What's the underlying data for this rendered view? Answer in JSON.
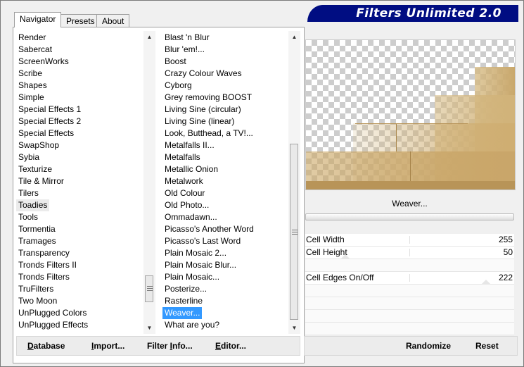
{
  "banner": {
    "title": "Filters Unlimited 2.0"
  },
  "tabs": [
    {
      "label": "Navigator",
      "active": true
    },
    {
      "label": "Presets",
      "active": false
    },
    {
      "label": "About",
      "active": false
    }
  ],
  "categories": {
    "items": [
      "Render",
      "Sabercat",
      "ScreenWorks",
      "Scribe",
      "Shapes",
      "Simple",
      "Special Effects 1",
      "Special Effects 2",
      "Special Effects",
      "SwapShop",
      "Sybia",
      "Texturize",
      "Tile & Mirror",
      "Tilers",
      "Toadies",
      "Tools",
      "Tormentia",
      "Tramages",
      "Transparency",
      "Tronds Filters II",
      "Tronds Filters",
      "TruFilters",
      "Two Moon",
      "UnPlugged Colors",
      "UnPlugged Effects"
    ],
    "selected": "Toadies"
  },
  "filters": {
    "items": [
      "Blast 'n Blur",
      "Blur 'em!...",
      "Boost",
      "Crazy Colour Waves",
      "Cyborg",
      "Grey removing BOOST",
      "Living Sine (circular)",
      "Living Sine (linear)",
      "Look, Butthead, a TV!...",
      "Metalfalls II...",
      "Metalfalls",
      "Metallic Onion",
      "Metalwork",
      "Old Colour",
      "Old Photo...",
      "Ommadawn...",
      "Picasso's Another Word",
      "Picasso's Last Word",
      "Plain Mosaic 2...",
      "Plain Mosaic Blur...",
      "Plain Mosaic...",
      "Posterize...",
      "Rasterline",
      "Weaver...",
      "What are you?"
    ],
    "selected": "Weaver..."
  },
  "preview": {
    "filter_name": "Weaver...",
    "accent": "#c9a86c"
  },
  "params": [
    {
      "label": "Cell Width",
      "value": "255",
      "fraction": 1.0
    },
    {
      "label": "Cell Height",
      "value": "50",
      "fraction": 0.196
    },
    {
      "label": "Cell Edges On/Off",
      "value": "222",
      "fraction": 0.871
    }
  ],
  "buttons": {
    "database": {
      "u": "D",
      "rest": "atabase"
    },
    "import": {
      "u": "I",
      "rest": "mport..."
    },
    "filter_info": {
      "pre": "Filter ",
      "u": "I",
      "rest": "nfo..."
    },
    "editor": {
      "u": "E",
      "rest": "ditor..."
    },
    "randomize": {
      "label": "Randomize"
    },
    "reset": {
      "label": "Reset"
    }
  }
}
